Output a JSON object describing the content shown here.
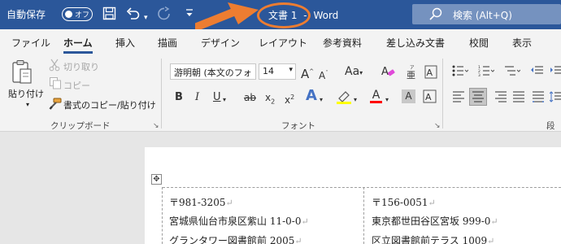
{
  "titlebar": {
    "autosave_label": "自動保存",
    "toggle_state": "オフ",
    "doc_name": "文書 1",
    "separator": "-",
    "app_name": "Word",
    "search_placeholder": "検索 (Alt+Q)"
  },
  "tabs": [
    "ファイル",
    "ホーム",
    "挿入",
    "描画",
    "デザイン",
    "レイアウト",
    "参考資料",
    "差し込み文書",
    "校閲",
    "表示"
  ],
  "active_tab": "ホーム",
  "clipboard": {
    "paste": "貼り付け",
    "cut": "切り取り",
    "copy": "コピー",
    "format_painter": "書式のコピー/貼り付け",
    "group_label": "クリップボード"
  },
  "font": {
    "font_name": "游明朝 (本文のフォ",
    "font_size": "14",
    "change_case": "Aa",
    "bold": "B",
    "italic": "I",
    "underline": "U",
    "strikethrough": "ab",
    "subscript": "x",
    "superscript": "x",
    "subscript_index": "2",
    "superscript_index": "2",
    "text_effect": "A",
    "highlight": "ab",
    "font_color": "A",
    "char_shading": "A",
    "group_label": "フォント"
  },
  "paragraph": {
    "group_label": "段落"
  },
  "document": {
    "left_cell": [
      "〒981-3205",
      "宮城県仙台市泉区紫山 11-0-0",
      "グランタワー図書館前 2005"
    ],
    "right_cell": [
      "〒156-0051",
      "東京都世田谷区宮坂 999-0",
      "区立図書館前テラス 1009"
    ]
  },
  "colors": {
    "title_bar": "#2b579a",
    "highlight_orange": "#ed7d31",
    "highlighter_yellow": "#ffff00",
    "font_color_red": "#ff0000"
  }
}
